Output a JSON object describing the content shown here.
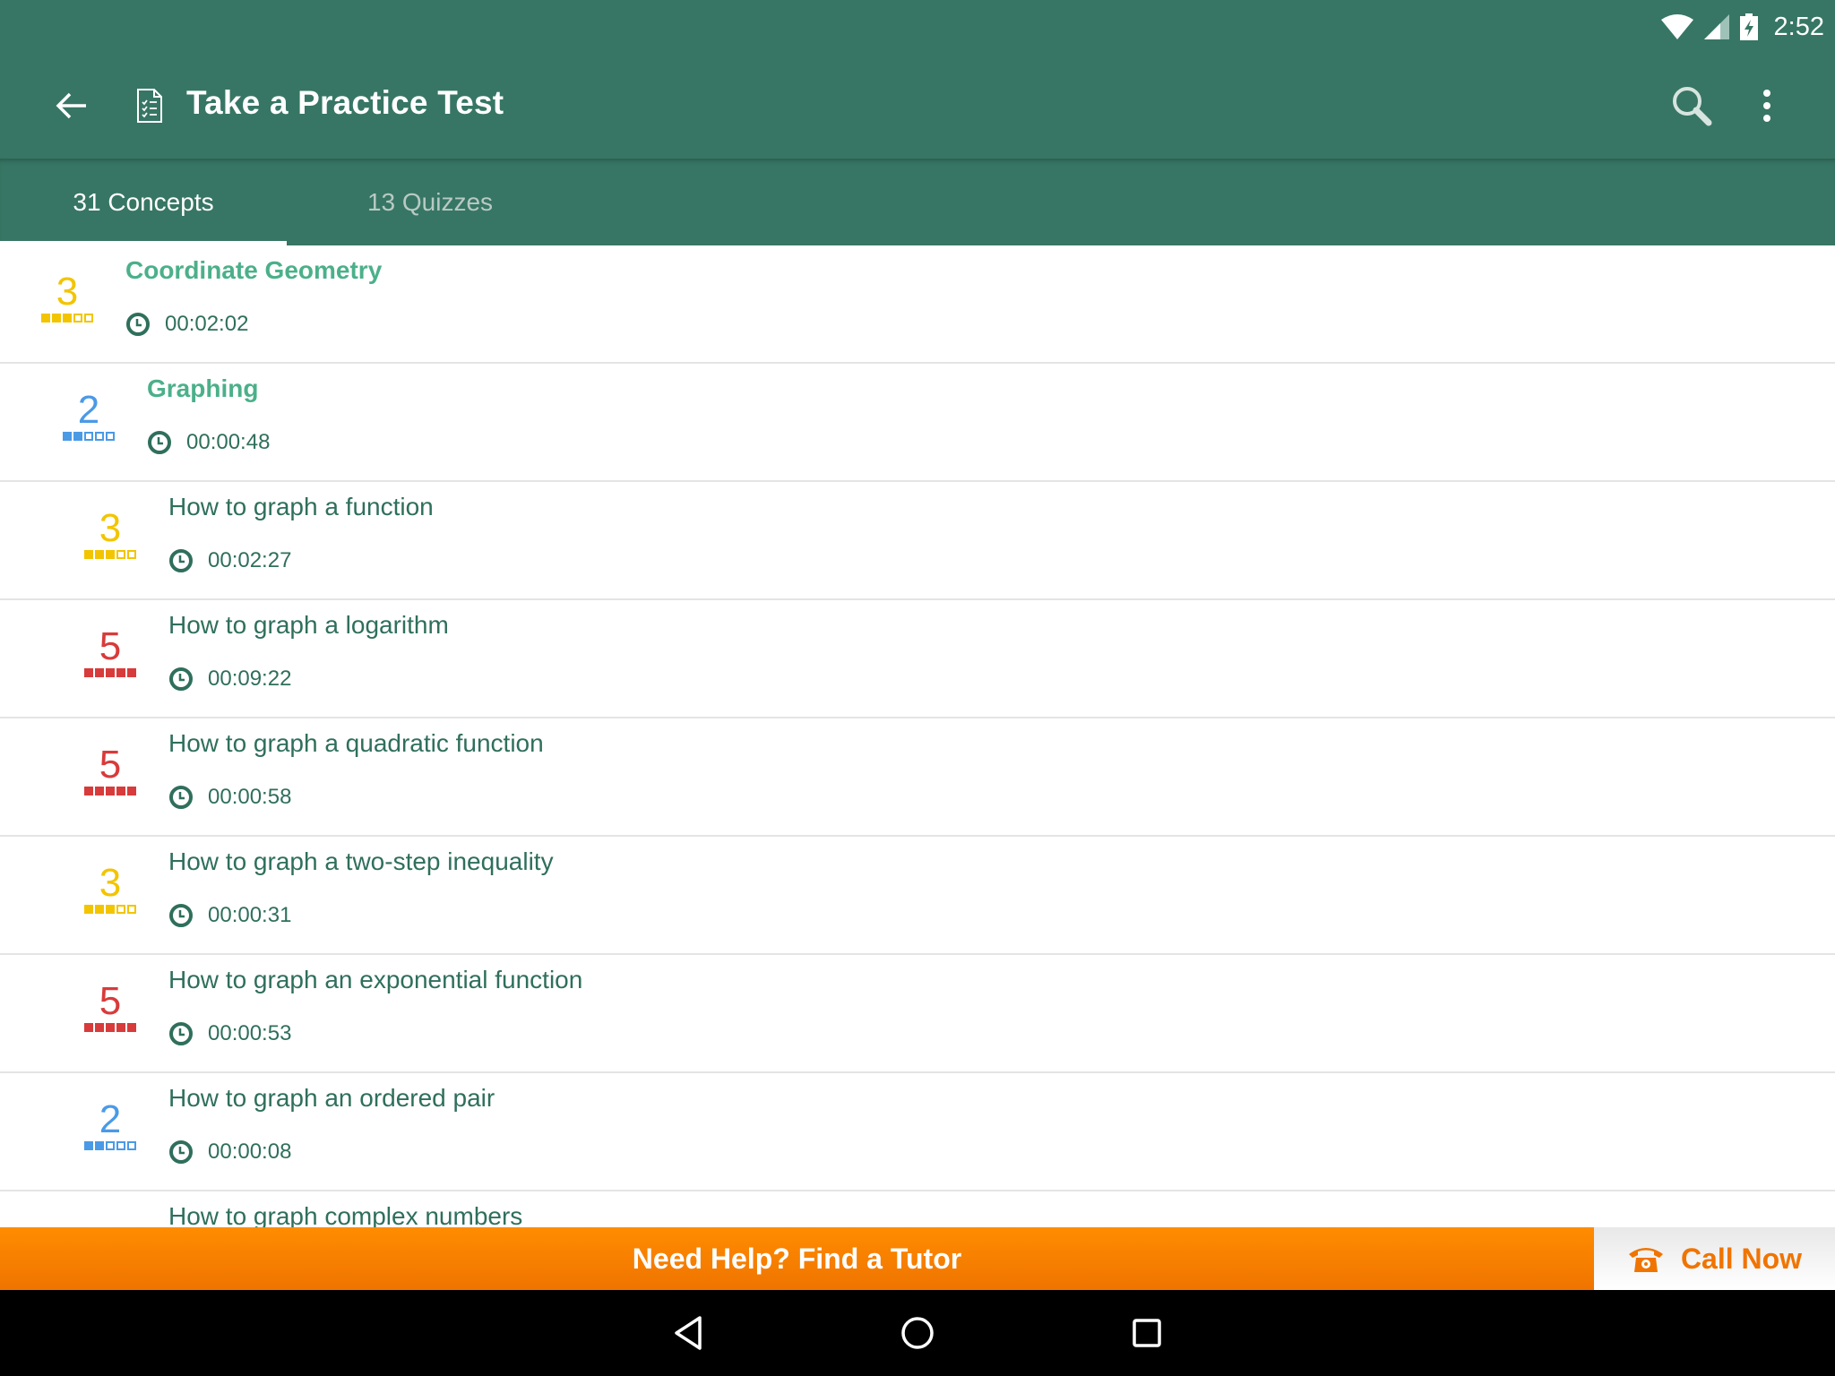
{
  "status_bar": {
    "time": "2:52",
    "icons": [
      "wifi-icon",
      "cellular-signal-icon",
      "battery-charging-icon"
    ]
  },
  "toolbar": {
    "title": "Take a Practice Test",
    "icons": {
      "back": "arrow-left-icon",
      "doc": "checklist-document-icon",
      "search": "search-icon",
      "more": "more-vertical-icon"
    }
  },
  "tabs": [
    {
      "label": "31 Concepts",
      "selected": true
    },
    {
      "label": "13 Quizzes",
      "selected": false
    }
  ],
  "difficulty_colors": {
    "2": "#4a9ae6",
    "3": "#f2c500",
    "5": "#d83b3b"
  },
  "list": [
    {
      "title": "Coordinate Geometry",
      "time": "00:02:02",
      "difficulty": 3,
      "is_header": true,
      "level": 0
    },
    {
      "title": "Graphing",
      "time": "00:00:48",
      "difficulty": 2,
      "is_header": true,
      "level": 1
    },
    {
      "title": "How to graph a function",
      "time": "00:02:27",
      "difficulty": 3,
      "is_header": false,
      "level": 2
    },
    {
      "title": "How to graph a logarithm",
      "time": "00:09:22",
      "difficulty": 5,
      "is_header": false,
      "level": 2
    },
    {
      "title": "How to graph a quadratic function",
      "time": "00:00:58",
      "difficulty": 5,
      "is_header": false,
      "level": 2
    },
    {
      "title": "How to graph a two-step inequality",
      "time": "00:00:31",
      "difficulty": 3,
      "is_header": false,
      "level": 2
    },
    {
      "title": "How to graph an exponential function",
      "time": "00:00:53",
      "difficulty": 5,
      "is_header": false,
      "level": 2
    },
    {
      "title": "How to graph an ordered pair",
      "time": "00:00:08",
      "difficulty": 2,
      "is_header": false,
      "level": 2
    },
    {
      "title": "How to graph complex numbers",
      "time": "",
      "difficulty": null,
      "is_header": false,
      "level": 2
    }
  ],
  "banner": {
    "tutor_label": "Need Help? Find a Tutor",
    "call_label": "Call Now",
    "call_icon": "telephone-icon"
  },
  "nav_bar": {
    "buttons": [
      "back-triangle-icon",
      "home-circle-icon",
      "recents-square-icon"
    ]
  }
}
